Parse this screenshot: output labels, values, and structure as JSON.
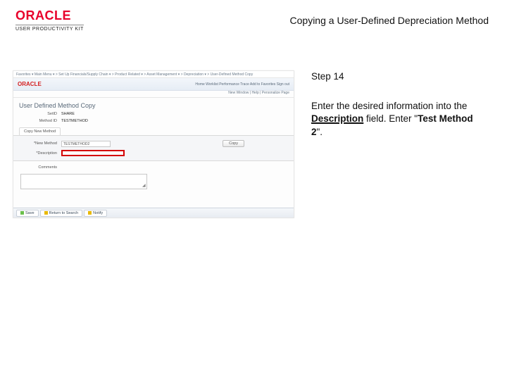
{
  "header": {
    "logo_text": "ORACLE",
    "logo_sub": "USER PRODUCTIVITY KIT",
    "title": "Copying a User-Defined Depreciation Method"
  },
  "instructions": {
    "step": "Step 14",
    "line1": "Enter the desired information into the ",
    "bold_field": "Description",
    "line2": " field. Enter \"",
    "bold_value": "Test Method 2",
    "line3": "\"."
  },
  "screenshot": {
    "breadcrumb": "Favorites ▾   Main Menu ▾   >  Set Up Financials/Supply Chain ▾  >  Product Related ▾  >  Asset Management ▾  >  Depreciation ▾  >  User-Defined Method Copy",
    "brand": "ORACLE",
    "top_links": "Home   Worklist   Performance Trace   Add to Favorites   Sign out",
    "sub_links": "New Window | Help | Personalize Page",
    "h1": "User Defined Method Copy",
    "setid_label": "SetID",
    "setid_value": "SHARE",
    "method_label": "Method ID",
    "method_value": "TESTMETHOD",
    "tab": "Copy New Method",
    "newmethod_label": "*New Method",
    "newmethod_value": "TESTMETHOD2",
    "copy_btn": "Copy",
    "desc_label": "*Description",
    "desc_value": "",
    "comments_label": "Comments",
    "footer_save": "Save",
    "footer_return": "Return to Search",
    "footer_notify": "Notify"
  }
}
